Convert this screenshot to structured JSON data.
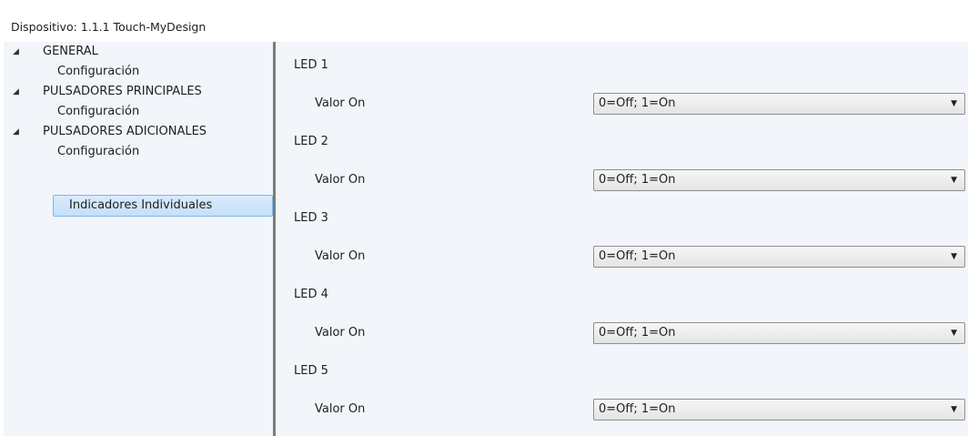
{
  "window": {
    "title": "Dispositivo: 1.1.1  Touch-MyDesign"
  },
  "tree": {
    "expand_glyph": "◢",
    "groups": [
      {
        "label": "GENERAL",
        "children": [
          "Configuración"
        ]
      },
      {
        "label": "PULSADORES PRINCIPALES",
        "children": [
          "Configuración"
        ]
      },
      {
        "label": "PULSADORES ADICIONALES",
        "children": [
          "Configuración",
          "Indicadores Individuales"
        ]
      }
    ],
    "selected": "Indicadores Individuales"
  },
  "content": {
    "leds": [
      {
        "title": "LED 1",
        "param_label": "Valor On",
        "value": "0=Off; 1=On"
      },
      {
        "title": "LED 2",
        "param_label": "Valor On",
        "value": "0=Off; 1=On"
      },
      {
        "title": "LED 3",
        "param_label": "Valor On",
        "value": "0=Off; 1=On"
      },
      {
        "title": "LED 4",
        "param_label": "Valor On",
        "value": "0=Off; 1=On"
      },
      {
        "title": "LED 5",
        "param_label": "Valor On",
        "value": "0=Off; 1=On"
      }
    ],
    "dropdown_caret": "▼"
  },
  "colors": {
    "panel_background": "#f2f5fa",
    "selection_background": "#cfe5fb",
    "selection_border": "#7fb7ea",
    "splitter": "#7b7b7b"
  }
}
